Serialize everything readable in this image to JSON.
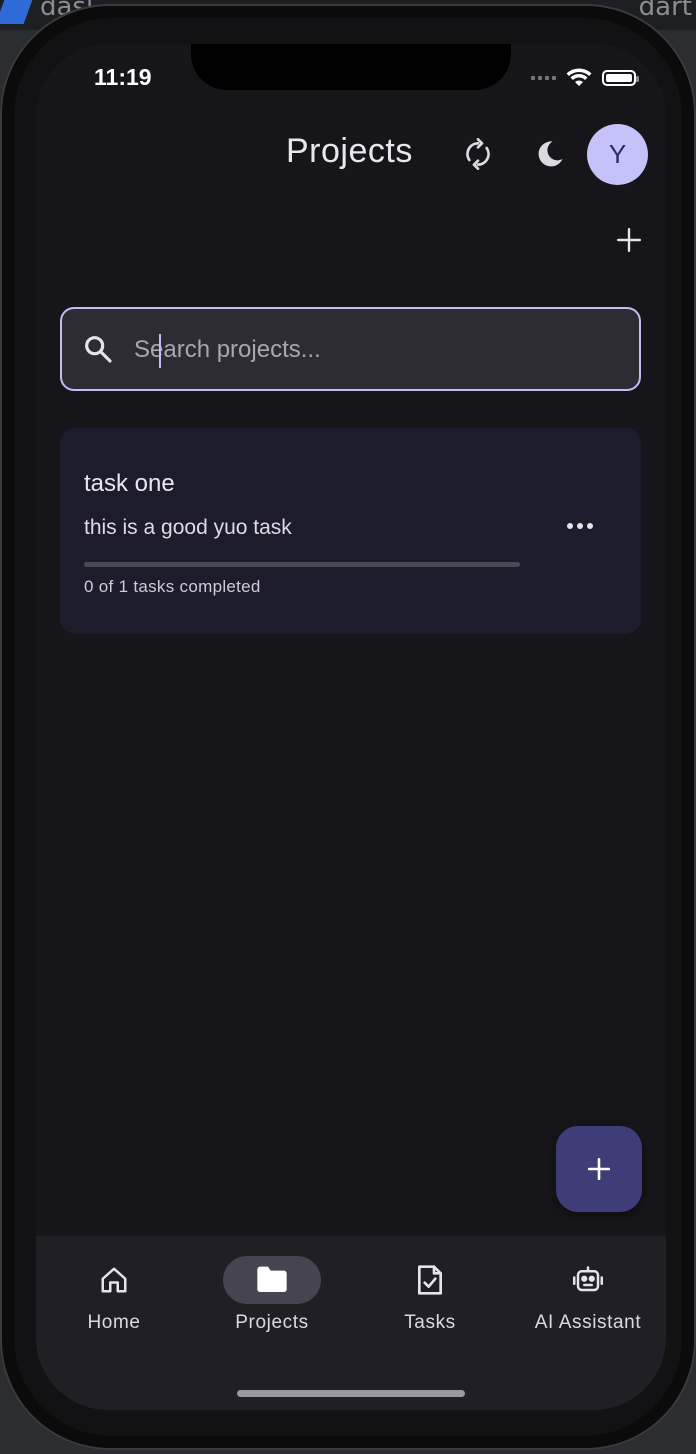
{
  "backdrop": {
    "left_text": "dasl",
    "right_text": "dart"
  },
  "status_bar": {
    "time": "11:19"
  },
  "header": {
    "title": "Projects",
    "avatar_initial": "Y",
    "sync_icon": "sync-icon",
    "theme_icon": "moon-icon",
    "add_icon": "plus-icon"
  },
  "search": {
    "placeholder": "Search projects...",
    "value": ""
  },
  "projects": [
    {
      "title": "task one",
      "description": "this is a good yuo task",
      "progress_text": "0 of 1 tasks completed",
      "completed": 0,
      "total": 1,
      "more_icon": "more-horizontal-icon"
    }
  ],
  "fab": {
    "icon": "plus-icon"
  },
  "nav": {
    "items": [
      {
        "label": "Home",
        "icon": "home-icon",
        "active": false
      },
      {
        "label": "Projects",
        "icon": "folder-icon",
        "active": true
      },
      {
        "label": "Tasks",
        "icon": "task-check-icon",
        "active": false
      },
      {
        "label": "AI Assistant",
        "icon": "robot-icon",
        "active": false
      }
    ]
  },
  "colors": {
    "accent": "#c5c1f9",
    "fab": "#3f3d78",
    "card": "#1d1c2d",
    "background": "#161519"
  }
}
